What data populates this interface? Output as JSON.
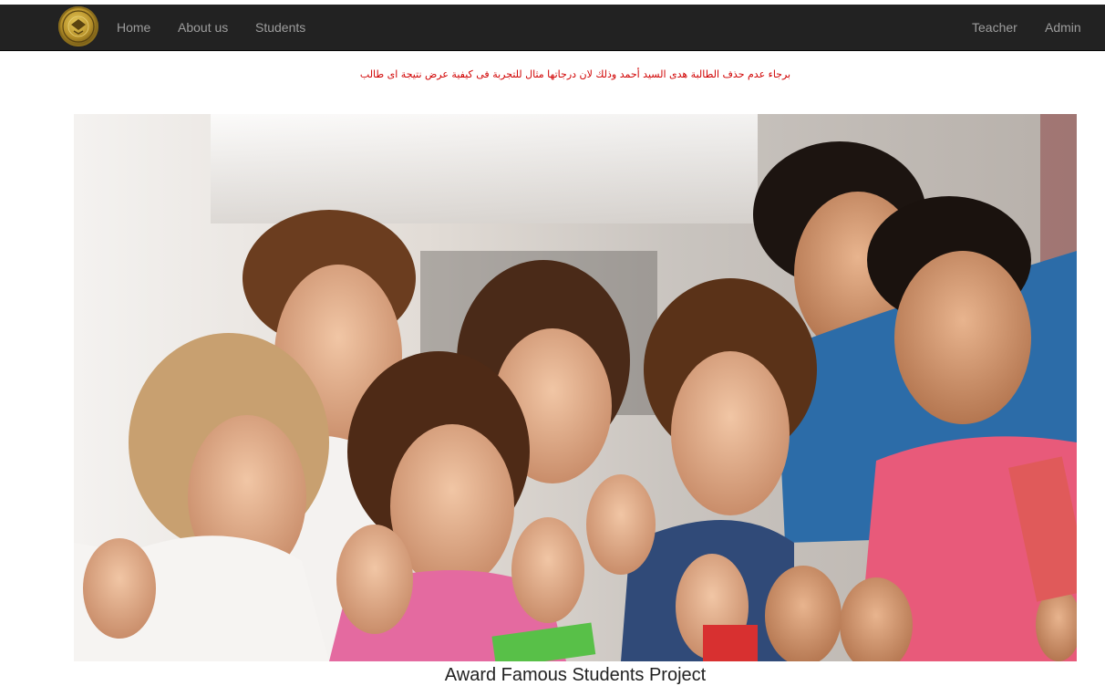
{
  "navbar": {
    "logo_icon": "school-emblem-icon",
    "left_links": [
      "Home",
      "About us",
      "Students"
    ],
    "right_links": [
      "Teacher",
      "Admin"
    ],
    "background": "#222222",
    "link_color": "#9d9d9d"
  },
  "notice": {
    "text": "برجاء عدم حذف الطالبة هدى السيد أحمد وذلك لان درجاتها مثال للتجربة فى كيفية عرض نتيجة اى طالب",
    "color": "#d00000"
  },
  "hero": {
    "image_icon": "students-thumbs-up-photo"
  },
  "caption": {
    "text": "Award Famous Students Project"
  }
}
